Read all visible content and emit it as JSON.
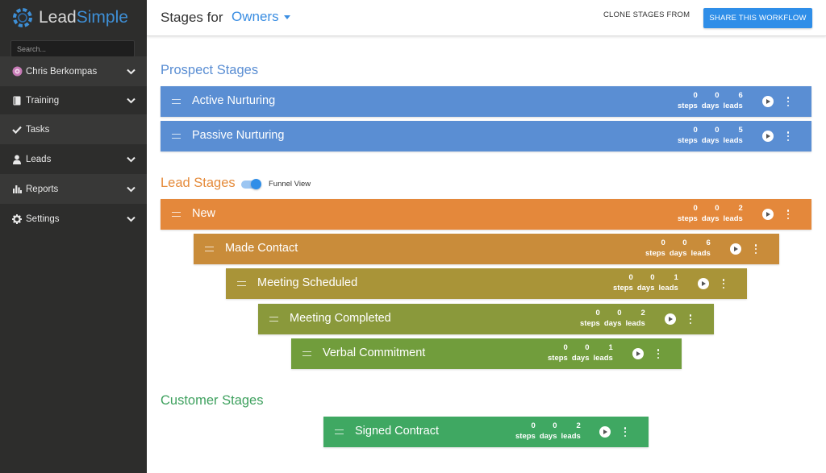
{
  "sidebar": {
    "logo": {
      "part1": "Lead",
      "part2": "Simple"
    },
    "search_placeholder": "Search...",
    "items": [
      {
        "label": "Chris Berkompas",
        "icon": "avatar-icon",
        "chevron": true
      },
      {
        "label": "Training",
        "icon": "book-icon",
        "chevron": true
      },
      {
        "label": "Tasks",
        "icon": "check-icon",
        "chevron": false
      },
      {
        "label": "Leads",
        "icon": "user-icon",
        "chevron": true
      },
      {
        "label": "Reports",
        "icon": "bar-chart-icon",
        "chevron": true
      },
      {
        "label": "Settings",
        "icon": "gear-icon",
        "chevron": true
      }
    ]
  },
  "header": {
    "title": "Stages for",
    "selected_workflow": "Owners",
    "clone_label": "CLONE STAGES FROM",
    "share_label": "SHARE THIS WORKFLOW"
  },
  "sections": {
    "prospect": "Prospect Stages",
    "lead": "Lead Stages",
    "customer": "Customer Stages",
    "funnel_view_label": "Funnel View",
    "funnel_view_on": true
  },
  "stat_labels": {
    "steps": "steps",
    "days": "days",
    "leads": "leads"
  },
  "colors": {
    "prospect": "#5a8ed3",
    "new": "#e4883b",
    "made_contact": "#c98c3a",
    "meeting_scheduled": "#a99438",
    "meeting_completed": "#8a993b",
    "verbal_commitment": "#719d3c",
    "signed_contract": "#3fa862",
    "accent": "#2f8ee8"
  },
  "stages": {
    "prospect": [
      {
        "name": "Active Nurturing",
        "steps": "0",
        "days": "0",
        "leads": "6"
      },
      {
        "name": "Passive Nurturing",
        "steps": "0",
        "days": "0",
        "leads": "5"
      }
    ],
    "lead": [
      {
        "name": "New",
        "steps": "0",
        "days": "0",
        "leads": "2"
      },
      {
        "name": "Made Contact",
        "steps": "0",
        "days": "0",
        "leads": "6"
      },
      {
        "name": "Meeting Scheduled",
        "steps": "0",
        "days": "0",
        "leads": "1"
      },
      {
        "name": "Meeting Completed",
        "steps": "0",
        "days": "0",
        "leads": "2"
      },
      {
        "name": "Verbal Commitment",
        "steps": "0",
        "days": "0",
        "leads": "1"
      }
    ],
    "customer": [
      {
        "name": "Signed Contract",
        "steps": "0",
        "days": "0",
        "leads": "2"
      }
    ]
  }
}
